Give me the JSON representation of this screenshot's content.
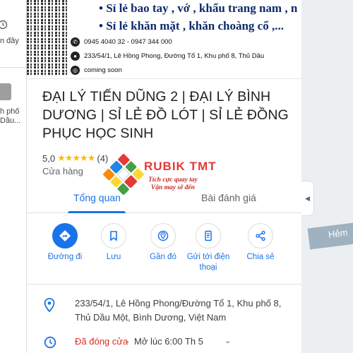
{
  "left_panel": {
    "recent_text": "n đây",
    "place_text_line1": "h phố",
    "place_text_line2": "Dầu..."
  },
  "photo": {
    "bullet_1": "• Sỉ lẻ bao tay , vớ , khẩu trang nam , n",
    "bullet_2": "• Sỉ lẻ khăn mặt , khăn choàng cổ ,...",
    "phone": "0945 4040 32 - 0947 344 000",
    "address": "233/54/1, Lê Hồng Phong, Đường Tổ 1, Khu phố 8, Thủ Dầu",
    "website": "coming soon"
  },
  "place": {
    "title": "ĐẠI LÝ TIẾN DŨNG 2 | ĐẠI LÝ BÌNH DƯƠNG | SỈ LẺ ĐỒ LÓT | SỈ LẺ ĐỒNG PHỤC HỌC SINH",
    "rating_value": "5,0",
    "stars": "★★★★★",
    "review_count": "(4)",
    "category": "Cửa hàng"
  },
  "tabs": [
    {
      "label": "Tổng quan",
      "active": true
    },
    {
      "label": "Bài đánh giá",
      "active": false
    }
  ],
  "watermark": {
    "brand": "RUBIK TMT",
    "slogan_1": "Tích cực quay tay",
    "slogan_2": "Vận may sẽ đến"
  },
  "actions": [
    {
      "label": "Đường đi",
      "icon": "directions-icon"
    },
    {
      "label": "Lưu",
      "icon": "bookmark-icon"
    },
    {
      "label": "Gần đó",
      "icon": "nearby-icon"
    },
    {
      "label": "Gửi tới điện thoại",
      "icon": "send-to-phone-icon"
    },
    {
      "label": "Chia sẻ",
      "icon": "share-icon"
    }
  ],
  "details": {
    "address": "233/54/1, Lê Hồng Phong/Đường Tổ 1, Khu phố 8, Thủ Dầu Một, Bình Dương, Việt Nam",
    "status": "Đã đóng cửa",
    "separator": "·",
    "next_open": "Mở lúc 6:00 Th 5"
  },
  "map": {
    "road_label": "Hẻm"
  },
  "colors": {
    "accent": "#1a73e8",
    "closed": "#d93025",
    "star": "#fbbc04",
    "photo_text": "#0d2a6b",
    "watermark": "#e53935"
  }
}
